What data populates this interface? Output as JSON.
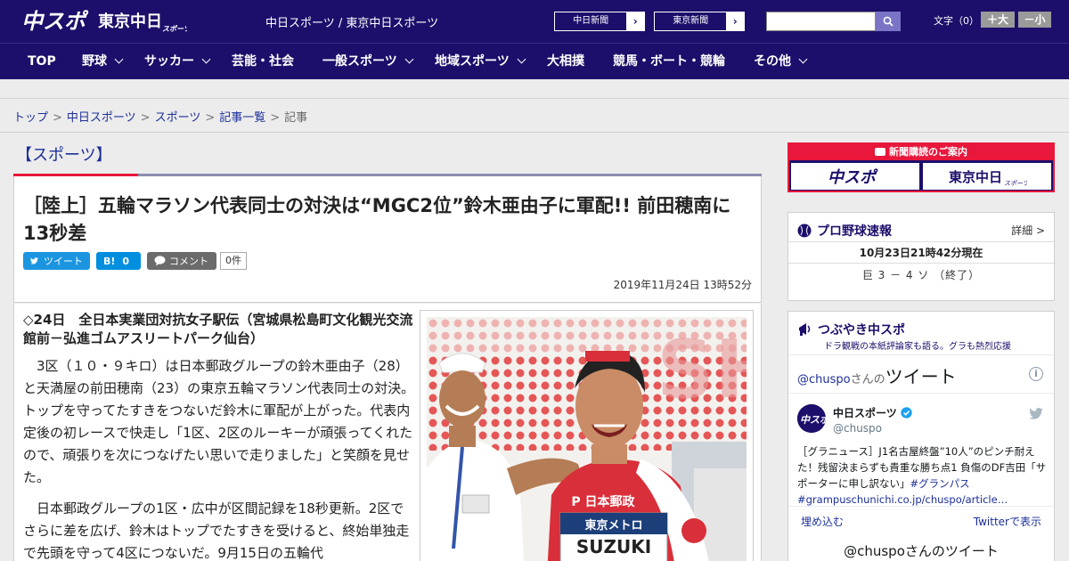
{
  "header": {
    "logo_chuspo": "中スポ",
    "logo_tokyo_main": "東京中日",
    "logo_tokyo_sub": "スポーツ",
    "site_title": "中日スポーツ / 東京中日スポーツ",
    "paper_links": [
      {
        "label": "中日新聞",
        "arrow": "›"
      },
      {
        "label": "東京新聞",
        "arrow": "›"
      }
    ],
    "search": {
      "placeholder": "",
      "icon": "search-icon"
    },
    "font_size": {
      "label": "文字（0）",
      "larger": "＋大",
      "smaller": "－小"
    },
    "colors": {
      "brand": "#1c0f6b",
      "accent": "#e8173b"
    }
  },
  "nav": {
    "items": [
      {
        "label": "TOP",
        "dropdown": false
      },
      {
        "label": "野球",
        "dropdown": true
      },
      {
        "label": "サッカー",
        "dropdown": true
      },
      {
        "label": "芸能・社会",
        "dropdown": false
      },
      {
        "label": "一般スポーツ",
        "dropdown": true
      },
      {
        "label": "地域スポーツ",
        "dropdown": true
      },
      {
        "label": "大相撲",
        "dropdown": false
      },
      {
        "label": "競馬・ボート・競輪",
        "dropdown": false
      },
      {
        "label": "その他",
        "dropdown": true
      }
    ]
  },
  "breadcrumb": {
    "items": [
      "トップ",
      "中日スポーツ",
      "スポーツ",
      "記事一覧"
    ],
    "current": "記事",
    "separator": ">"
  },
  "article": {
    "section": "【スポーツ】",
    "headline": "［陸上］五輪マラソン代表同士の対決は“MGC2位”鈴木亜由子に軍配!! 前田穂南に13秒差",
    "share": {
      "tweet": "ツイート",
      "hatena_label": "B!",
      "hatena_count": "0",
      "comment": "コメント",
      "comment_count": "0件"
    },
    "date": "2019年11月24日 13時52分",
    "lead": "◇24日　全日本実業団対抗女子駅伝（宮城県松島町文化観光交流館前－弘進ゴムアスリートパーク仙台）",
    "paragraphs": [
      "3区（１０・９キロ）は日本郵政グループの鈴木亜由子（28）と天満屋の前田穂南（23）の東京五輪マラソン代表同士の対決。トップを守ってたすきをつないだ鈴木に軍配が上がった。代表内定後の初レースで快走し「1区、2区のルーキーが頑張ってくれたので、頑張りを次につなげたい思いで走りました」と笑顔を見せた。",
      "日本郵政グループの1区・広中が区間記録を18秒更新。2区でさらに差を広げ、鈴木はトップでたすきを受けると、終始単独走で先頭を守って4区につないだ。9月15日の五輪代"
    ],
    "photo_text": {
      "bib_line1": "P 日本郵政",
      "bib_line2": "東京メトロ",
      "bib_name": "SUZUKI",
      "backdrop": "SH"
    }
  },
  "sidebar": {
    "subscribe": {
      "title": "新聞購読のご案内",
      "logo1": "中スポ",
      "logo2_main": "東京中日",
      "logo2_sub": "スポーツ"
    },
    "baseball": {
      "title": "プロ野球速報",
      "more": "詳細 >",
      "time": "10月23日21時42分現在",
      "score": "巨 3 － 4 ソ （終了）"
    },
    "twitter": {
      "title": "つぶやき中スポ",
      "subtitle": "ドラ観戦の本紙評論家も語る。グラも熱烈応援",
      "head_handle": "@chuspo",
      "head_san": "さんの",
      "head_tweet": "ツイート",
      "info": "i",
      "account_name": "中日スポーツ",
      "account_handle": "@chuspo",
      "tweet_text": "［グラニュース］J1名古屋終盤”10人”のピンチ耐えた！残留決まらずも貴重な勝ち点1 負傷のDF吉田「サポーターに申し訳ない」",
      "hashtag": "#グランパス",
      "link": "#grampuschunichi.co.jp/chuspo/article…",
      "embed": "埋め込む",
      "view": "Twitterで表示",
      "next_header": "@chuspoさんのツイート"
    }
  }
}
